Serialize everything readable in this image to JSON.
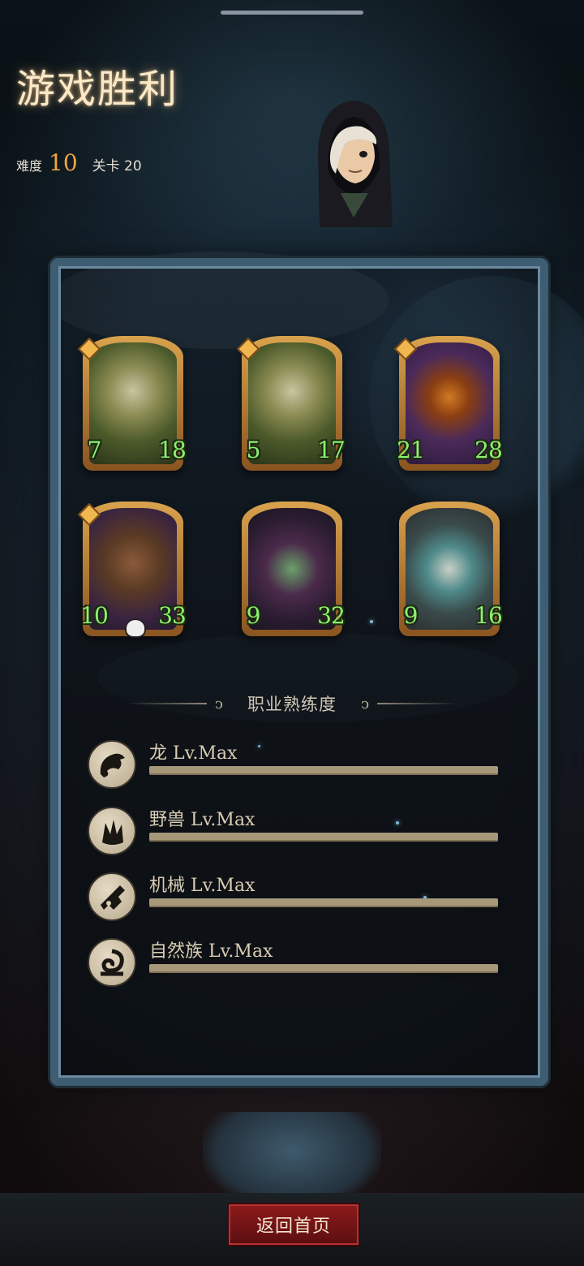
{
  "header": {
    "title": "游戏胜利",
    "difficulty_label": "难度",
    "difficulty_value": "10",
    "stage_label": "关卡 20"
  },
  "cards": [
    {
      "attack": "7",
      "health": "18",
      "art": "swamp-beast"
    },
    {
      "attack": "5",
      "health": "17",
      "art": "swamp-beast"
    },
    {
      "attack": "21",
      "health": "28",
      "art": "pumpkin-monster"
    },
    {
      "attack": "10",
      "health": "33",
      "art": "tiki-totem"
    },
    {
      "attack": "9",
      "health": "32",
      "art": "dark-elf"
    },
    {
      "attack": "9",
      "health": "16",
      "art": "horned-beast"
    }
  ],
  "mastery": {
    "title": "职业熟练度",
    "items": [
      {
        "label": "龙 Lv.Max",
        "icon": "dragon-icon",
        "progress": 1.0
      },
      {
        "label": "野兽 Lv.Max",
        "icon": "beast-icon",
        "progress": 1.0
      },
      {
        "label": "机械 Lv.Max",
        "icon": "mech-icon",
        "progress": 1.0
      },
      {
        "label": "自然族 Lv.Max",
        "icon": "nature-icon",
        "progress": 1.0
      }
    ]
  },
  "footer": {
    "home_button": "返回首页"
  },
  "colors": {
    "accent": "#f0a63b",
    "stat_green": "#8df06d",
    "button_red": "#8e1a1c"
  }
}
